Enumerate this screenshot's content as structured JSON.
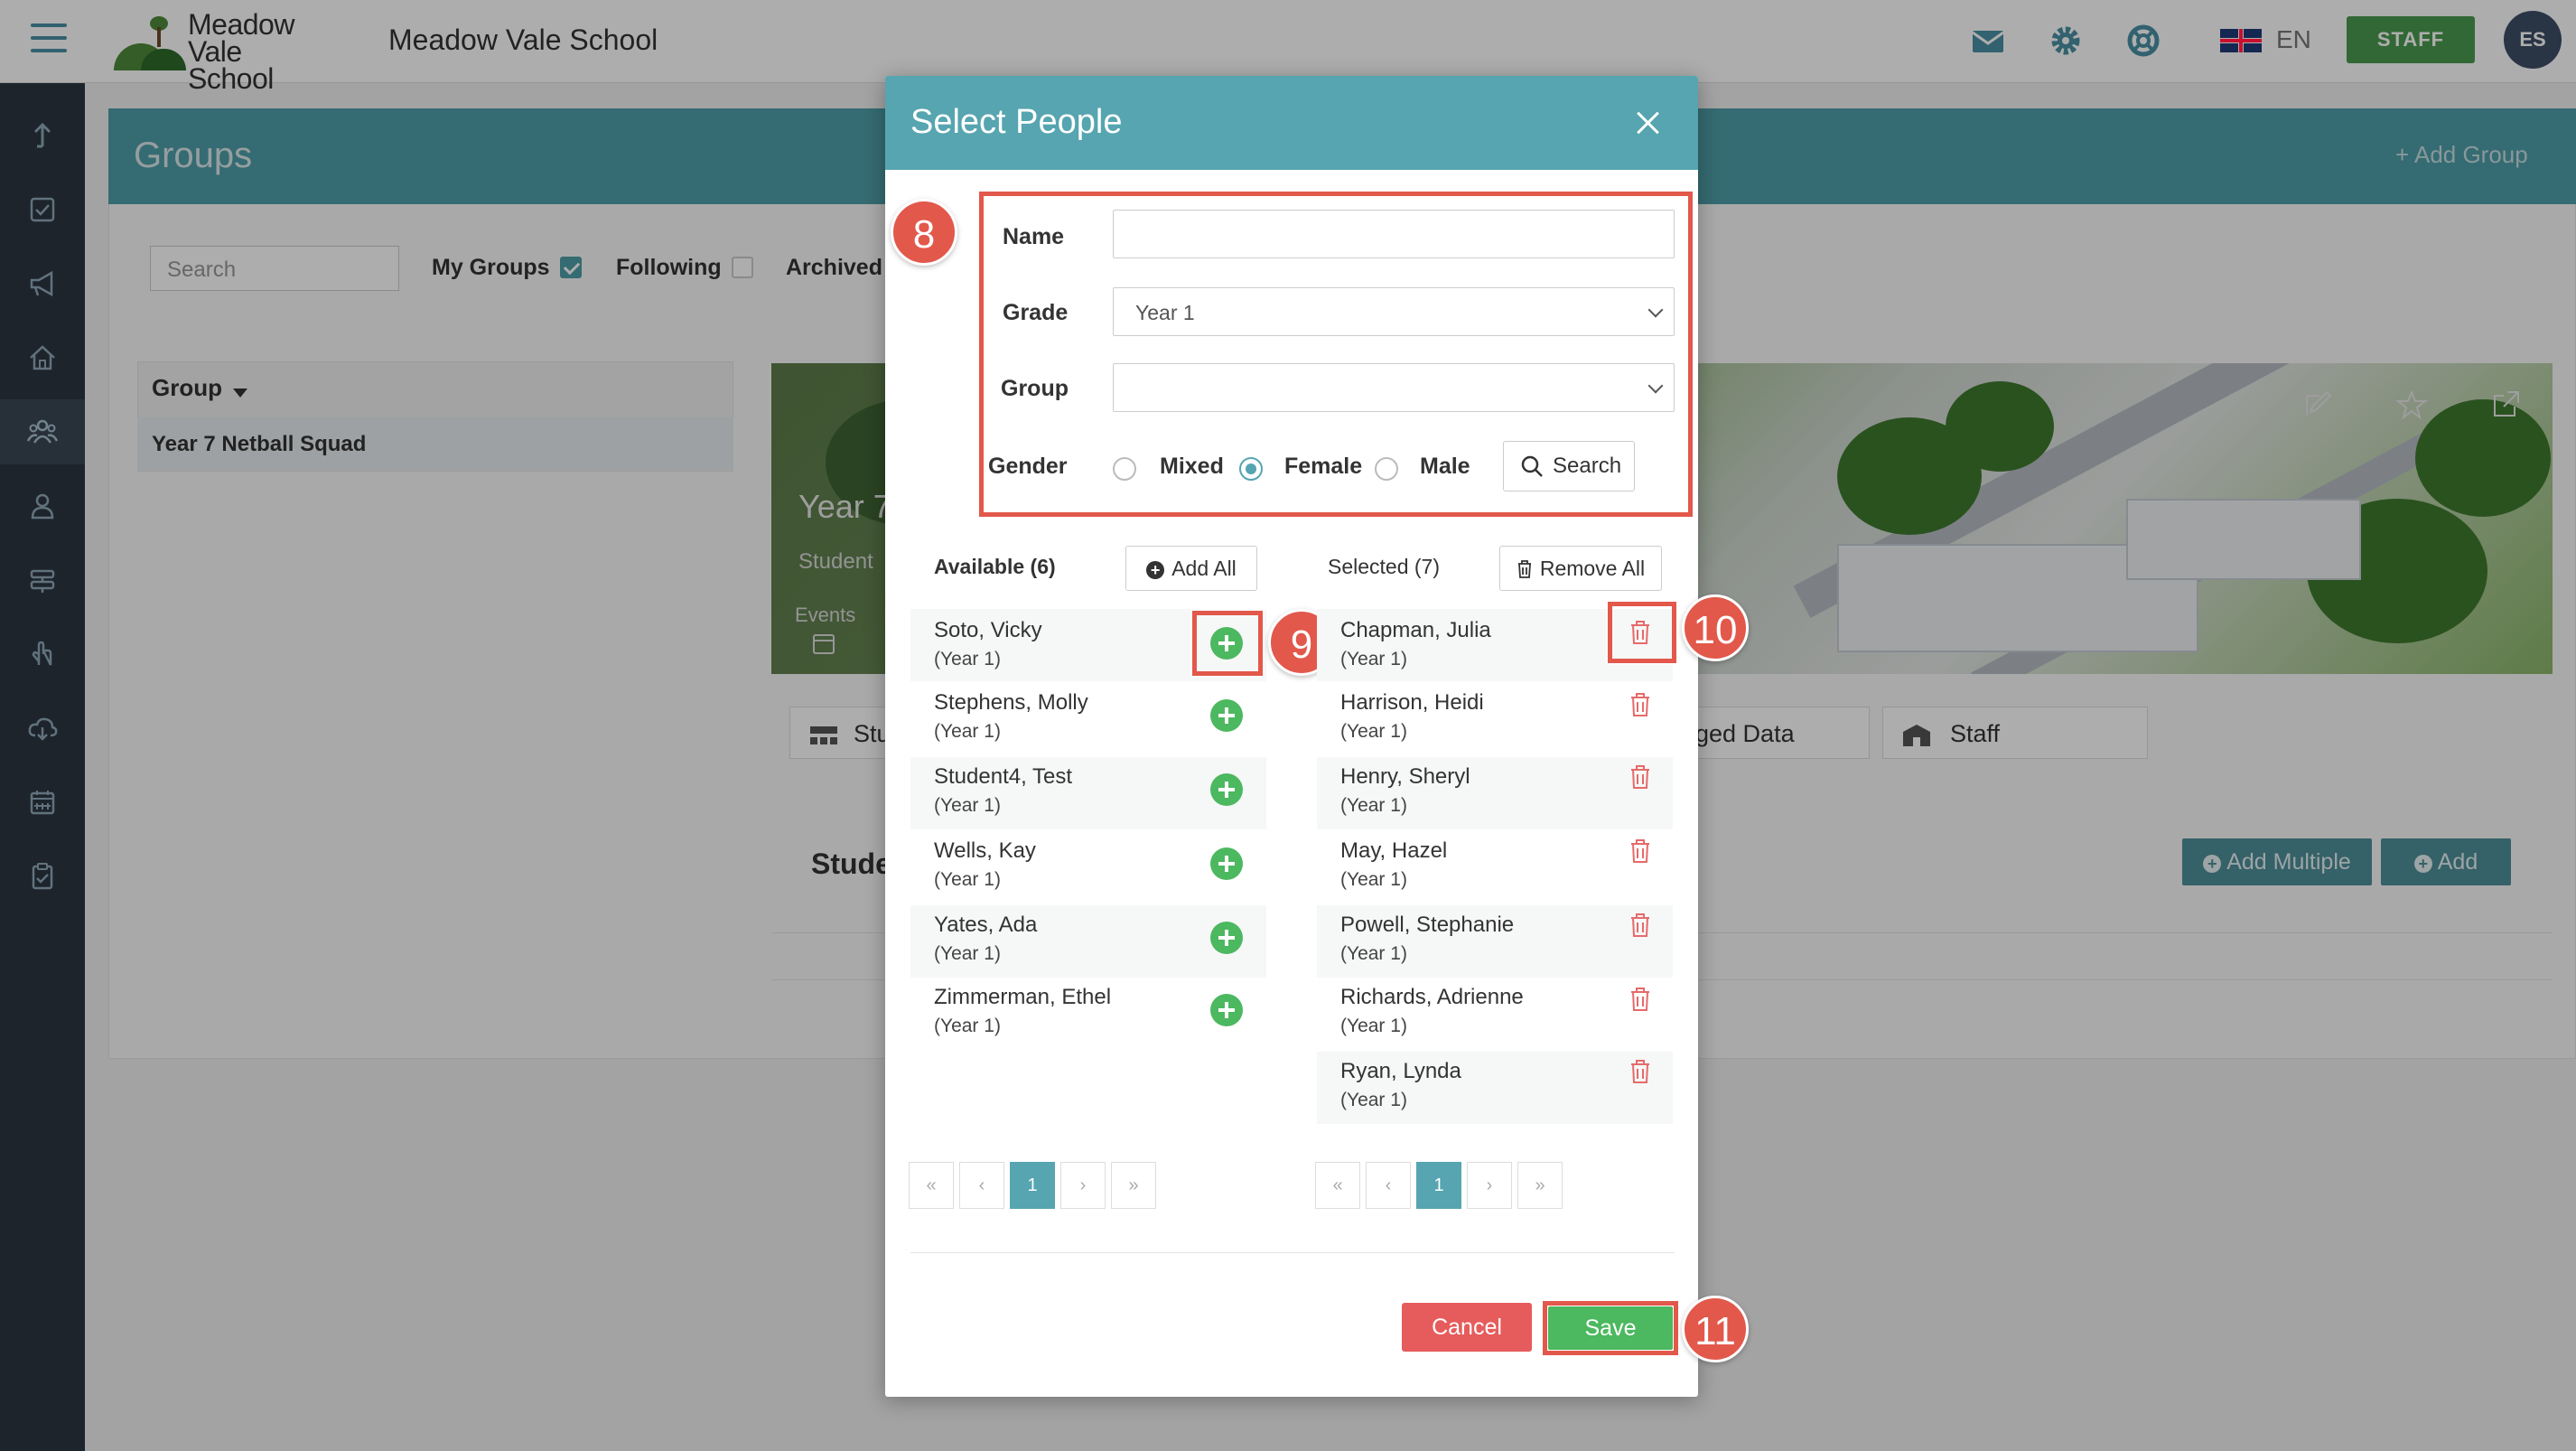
{
  "topbar": {
    "logo_line1": "Meadow",
    "logo_line2": "Vale School",
    "school_name": "Meadow Vale School",
    "language": "EN",
    "staff_label": "STAFF",
    "avatar_initials": "ES",
    "icons": [
      "mail-icon",
      "gear-icon",
      "lifebuoy-icon",
      "uk-flag-icon"
    ]
  },
  "sidebar": {
    "items": [
      "upload-icon",
      "checkbox-icon",
      "megaphone-icon",
      "home-icon",
      "people-icon",
      "person-icon",
      "layers-icon",
      "hand-icon",
      "cloud-download-icon",
      "calendar-icon",
      "clipboard-icon"
    ],
    "active_index": 4
  },
  "groups_page": {
    "title": "Groups",
    "add_group": "+ Add Group",
    "search_placeholder": "Search",
    "filters": [
      {
        "label": "My Groups",
        "checked": true
      },
      {
        "label": "Following",
        "checked": false
      },
      {
        "label": "Archived",
        "checked": false
      }
    ],
    "group_column": "Group",
    "group_row": "Year 7 Netball Squad",
    "banner_title": "Year 7",
    "banner_sub": "Student",
    "banner_events": "Events",
    "tabs": [
      "Stu",
      "ged Data",
      "Staff"
    ],
    "students_heading": "Stude",
    "add_multiple": "Add Multiple",
    "add": "Add"
  },
  "modal": {
    "title": "Select People",
    "name_label": "Name",
    "name_value": "",
    "grade_label": "Grade",
    "grade_value": "Year 1",
    "group_label": "Group",
    "group_value": "",
    "gender_label": "Gender",
    "gender_options": [
      "Mixed",
      "Female",
      "Male"
    ],
    "gender_selected": "Female",
    "search_button": "Search",
    "available_header": "Available (6)",
    "add_all": "Add All",
    "selected_header": "Selected (7)",
    "remove_all": "Remove All",
    "available": [
      {
        "name": "Soto, Vicky",
        "year": "(Year 1)"
      },
      {
        "name": "Stephens, Molly",
        "year": "(Year 1)"
      },
      {
        "name": "Student4, Test",
        "year": "(Year 1)"
      },
      {
        "name": "Wells, Kay",
        "year": "(Year 1)"
      },
      {
        "name": "Yates, Ada",
        "year": "(Year 1)"
      },
      {
        "name": "Zimmerman, Ethel",
        "year": "(Year 1)"
      }
    ],
    "selected": [
      {
        "name": "Chapman, Julia",
        "year": "(Year 1)"
      },
      {
        "name": "Harrison, Heidi",
        "year": "(Year 1)"
      },
      {
        "name": "Henry, Sheryl",
        "year": "(Year 1)"
      },
      {
        "name": "May, Hazel",
        "year": "(Year 1)"
      },
      {
        "name": "Powell, Stephanie",
        "year": "(Year 1)"
      },
      {
        "name": "Richards, Adrienne",
        "year": "(Year 1)"
      },
      {
        "name": "Ryan, Lynda",
        "year": "(Year 1)"
      }
    ],
    "pager": [
      "«",
      "‹",
      "1",
      "›",
      "»"
    ],
    "cancel": "Cancel",
    "save": "Save"
  },
  "annotations": [
    "8",
    "9",
    "10",
    "11"
  ],
  "colors": {
    "accent": "#56a5b0",
    "annotation": "#e2584b",
    "add_green": "#4cb85f",
    "cancel_red": "#e65c5c",
    "sidebar": "#2b3540"
  }
}
